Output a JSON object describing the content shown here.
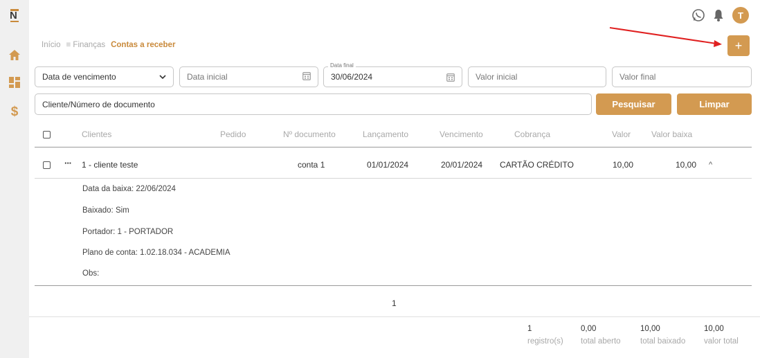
{
  "app": {
    "logo_text": "N"
  },
  "header": {
    "avatar_letter": "T"
  },
  "breadcrumb": {
    "home": "Início",
    "section": "Finanças",
    "current": "Contas a receber"
  },
  "add_button_label": "+",
  "filters": {
    "date_type": "Data de vencimento",
    "date_start": {
      "placeholder": "Data inicial",
      "value": ""
    },
    "date_end": {
      "label": "Data final",
      "value": "30/06/2024"
    },
    "value_start": {
      "placeholder": "Valor inicial"
    },
    "value_end": {
      "placeholder": "Valor final"
    },
    "search": {
      "placeholder": "Cliente/Número de documento"
    },
    "search_button": "Pesquisar",
    "clear_button": "Limpar"
  },
  "table": {
    "columns": [
      "Clientes",
      "Pedido",
      "Nº documento",
      "Lançamento",
      "Vencimento",
      "Cobrança",
      "Valor",
      "Valor baixa"
    ],
    "rows": [
      {
        "actions": "···",
        "cliente": "1 - cliente teste",
        "pedido": "",
        "documento": "conta 1",
        "lancamento": "01/01/2024",
        "vencimento": "20/01/2024",
        "cobranca": "CARTÃO CRÉDITO",
        "valor": "10,00",
        "valor_baixa": "10,00",
        "expand_icon": "^",
        "details": {
          "data_baixa": "Data da baixa: 22/06/2024",
          "baixado": "Baixado: Sim",
          "portador": "Portador: 1 - PORTADOR",
          "plano": "Plano de conta: 1.02.18.034 - ACADEMIA",
          "obs": "Obs:"
        }
      }
    ]
  },
  "pagination": {
    "page": "1"
  },
  "totals": [
    {
      "value": "1",
      "label": "registro(s)"
    },
    {
      "value": "0,00",
      "label": "total aberto"
    },
    {
      "value": "10,00",
      "label": "total baixado"
    },
    {
      "value": "10,00",
      "label": "valor total"
    }
  ],
  "colors": {
    "accent": "#d39a51",
    "breadcrumb_current": "#c98a3b",
    "annotation_arrow": "#e02020",
    "sidebar_bg": "#f0f0f0"
  }
}
